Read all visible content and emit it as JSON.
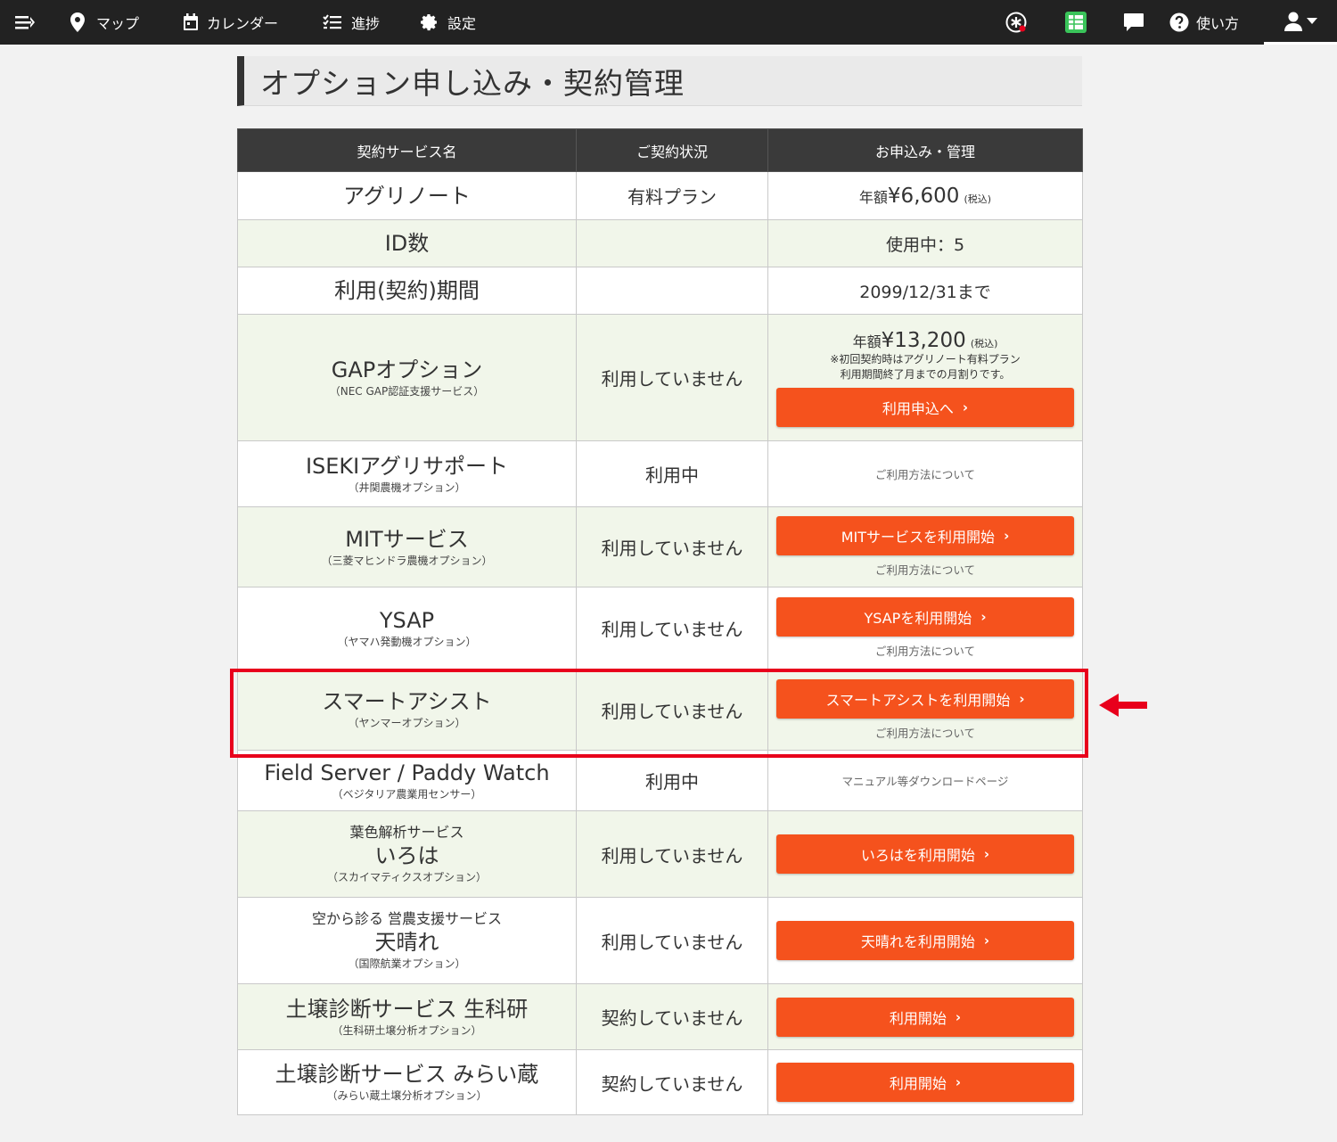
{
  "nav": {
    "map": "マップ",
    "calendar": "カレンダー",
    "progress": "進捗",
    "settings": "設定",
    "help": "使い方"
  },
  "page_title": "オプション申し込み・契約管理",
  "table": {
    "headers": [
      "契約サービス名",
      "ご契約状況",
      "お申込み・管理"
    ],
    "agrinote": {
      "name": "アグリノート",
      "status": "有料プラン",
      "price_label": "年額",
      "price": "¥6,600",
      "tax": "(税込)"
    },
    "id_count": {
      "name": "ID数",
      "value": "使用中：5"
    },
    "period": {
      "name": "利用(契約)期間",
      "value": "2099/12/31まで"
    },
    "gap": {
      "name": "GAPオプション",
      "sub": "（NEC GAP認証支援サービス）",
      "status": "利用していません",
      "price_label": "年額",
      "price": "¥13,200",
      "tax": "(税込)",
      "note1": "※初回契約時はアグリノート有料プラン",
      "note2": "利用期間終了月までの月割りです。",
      "button": "利用申込へ"
    },
    "iseki": {
      "name": "ISEKIアグリサポート",
      "sub": "（井関農機オプション）",
      "status": "利用中",
      "link": "ご利用方法について"
    },
    "mit": {
      "name": "MITサービス",
      "sub": "（三菱マヒンドラ農機オプション）",
      "status": "利用していません",
      "button": "MITサービスを利用開始",
      "link": "ご利用方法について"
    },
    "ysap": {
      "name": "YSAP",
      "sub": "（ヤマハ発動機オプション）",
      "status": "利用していません",
      "button": "YSAPを利用開始",
      "link": "ご利用方法について"
    },
    "smartassist": {
      "name": "スマートアシスト",
      "sub": "（ヤンマーオプション）",
      "status": "利用していません",
      "button": "スマートアシストを利用開始",
      "link": "ご利用方法について"
    },
    "fieldserver": {
      "name": "Field Server / Paddy Watch",
      "sub": "（ベジタリア農業用センサー）",
      "status": "利用中",
      "link": "マニュアル等ダウンロードページ"
    },
    "iroha": {
      "top": "葉色解析サービス",
      "name": "いろは",
      "sub": "（スカイマティクスオプション）",
      "status": "利用していません",
      "button": "いろはを利用開始"
    },
    "appare": {
      "top": "空から診る 営農支援サービス",
      "name": "天晴れ",
      "sub": "（国際航業オプション）",
      "status": "利用していません",
      "button": "天晴れを利用開始"
    },
    "seikaken": {
      "name": "土壌診断サービス 生科研",
      "sub": "（生科研土壌分析オプション）",
      "status": "契約していません",
      "button": "利用開始"
    },
    "miraikura": {
      "name": "土壌診断サービス みらい蔵",
      "sub": "（みらい蔵土壌分析オプション）",
      "status": "契約していません",
      "button": "利用開始"
    }
  },
  "colors": {
    "accent": "#f5521d",
    "highlight": "#e8001c",
    "header_bg": "#3a3a3a",
    "alt_row": "#f1f6ea"
  }
}
